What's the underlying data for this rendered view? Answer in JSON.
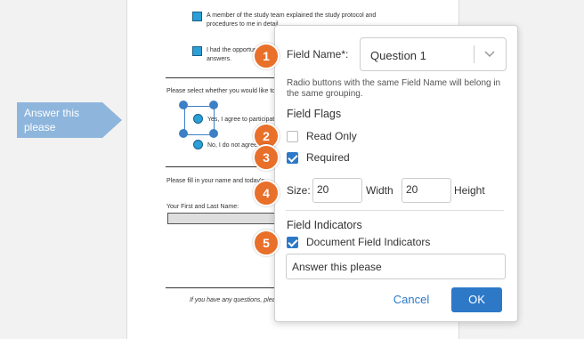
{
  "document": {
    "check1_text_l1": "A member of the study team explained the study protocol and",
    "check1_text_l2": "procedures to me in detail",
    "check2_text_l1": "I had the opportun",
    "check2_text_l2": "answers.",
    "select_prompt": "Please select whether you would like to",
    "radio_yes": "Yes, I agree to participate",
    "radio_no": "No, I do not agree t",
    "fill_prompt": "Please fill in your name and today's",
    "name_label": "Your First and Last Name:",
    "footer_text": "If you have any questions, please"
  },
  "field_tag": {
    "label": "Answer this please",
    "color": "#8eb6dd"
  },
  "panel": {
    "field_name_label": "Field Name*:",
    "field_name_value": "Question 1",
    "hint": "Radio buttons with the same Field Name will belong in the same grouping.",
    "flags_heading": "Field Flags",
    "read_only_label": "Read Only",
    "read_only_checked": false,
    "required_label": "Required",
    "required_checked": true,
    "size_label": "Size:",
    "width_value": "20",
    "width_label": "Width",
    "height_value": "20",
    "height_label": "Height",
    "indicators_heading": "Field Indicators",
    "doc_indicators_label": "Document Field Indicators",
    "doc_indicators_checked": true,
    "indicator_text": "Answer this please",
    "cancel_label": "Cancel",
    "ok_label": "OK"
  },
  "callouts": [
    "1",
    "2",
    "3",
    "4",
    "5"
  ],
  "colors": {
    "accent": "#2d79c7",
    "callout": "#e8702a",
    "tag": "#8eb6dd"
  }
}
